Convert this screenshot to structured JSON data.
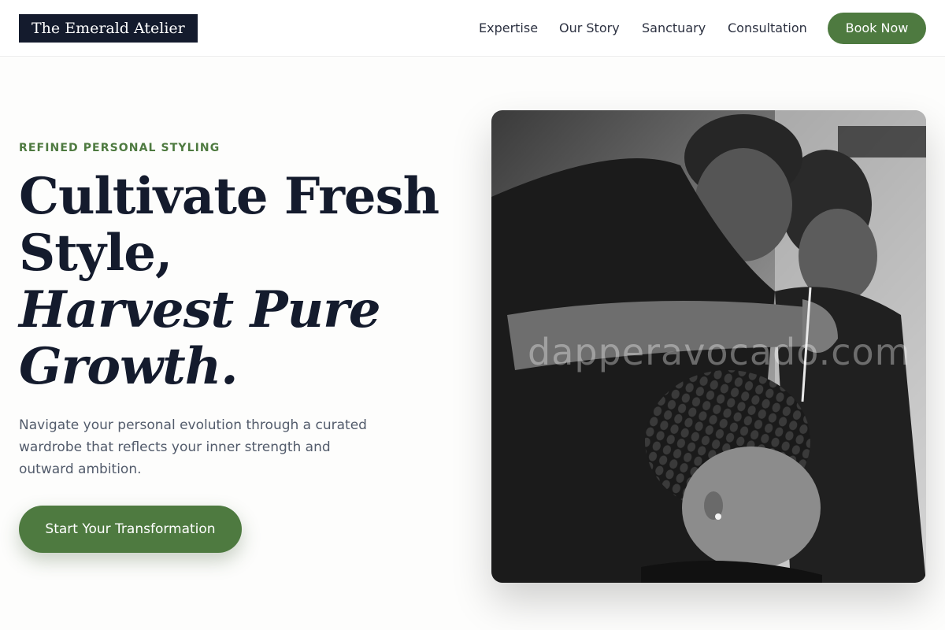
{
  "header": {
    "logo": "The Emerald Atelier",
    "nav": [
      "Expertise",
      "Our Story",
      "Sanctuary",
      "Consultation"
    ],
    "cta": "Book Now"
  },
  "hero": {
    "eyebrow": "REFINED PERSONAL STYLING",
    "headline": {
      "line1": "Cultivate Fresh",
      "line2": "Style,",
      "line3": "Harvest Pure",
      "line4": "Growth."
    },
    "description": "Navigate your personal evolution through a curated wardrobe that reflects your inner strength and outward ambition.",
    "cta": "Start Your Transformation",
    "image_watermark": "dapperavocado.com"
  },
  "colors": {
    "brand_green": "#4e7a40",
    "navy": "#141b2d",
    "body_text": "#525b6b"
  }
}
